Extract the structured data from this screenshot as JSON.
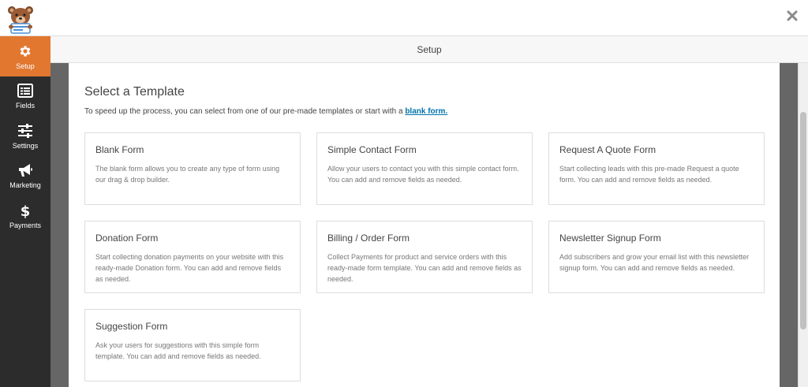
{
  "header": {
    "title": "Setup"
  },
  "sidebar": {
    "items": [
      {
        "label": "Setup",
        "icon": "gear-icon",
        "active": true
      },
      {
        "label": "Fields",
        "icon": "fields-list-icon",
        "active": false
      },
      {
        "label": "Settings",
        "icon": "sliders-icon",
        "active": false
      },
      {
        "label": "Marketing",
        "icon": "megaphone-icon",
        "active": false
      },
      {
        "label": "Payments",
        "icon": "dollar-icon",
        "active": false
      }
    ]
  },
  "main": {
    "heading": "Select a Template",
    "intro_text": "To speed up the process, you can select from one of our pre-made templates or start with a ",
    "intro_link": "blank form.",
    "templates": [
      {
        "title": "Blank Form",
        "description": "The blank form allows you to create any type of form using our drag & drop builder."
      },
      {
        "title": "Simple Contact Form",
        "description": "Allow your users to contact you with this simple contact form. You can add and remove fields as needed."
      },
      {
        "title": "Request A Quote Form",
        "description": "Start collecting leads with this pre-made Request a quote form. You can add and remove fields as needed."
      },
      {
        "title": "Donation Form",
        "description": "Start collecting donation payments on your website with this ready-made Donation form. You can add and remove fields as needed."
      },
      {
        "title": "Billing / Order Form",
        "description": "Collect Payments for product and service orders with this ready-made form template. You can add and remove fields as needed."
      },
      {
        "title": "Newsletter Signup Form",
        "description": "Add subscribers and grow your email list with this newsletter signup form. You can add and remove fields as needed."
      },
      {
        "title": "Suggestion Form",
        "description": "Ask your users for suggestions with this simple form template. You can add and remove fields as needed."
      }
    ]
  },
  "colors": {
    "accent": "#e27730",
    "sidebar": "#2c2c2c",
    "link": "#0073aa"
  }
}
